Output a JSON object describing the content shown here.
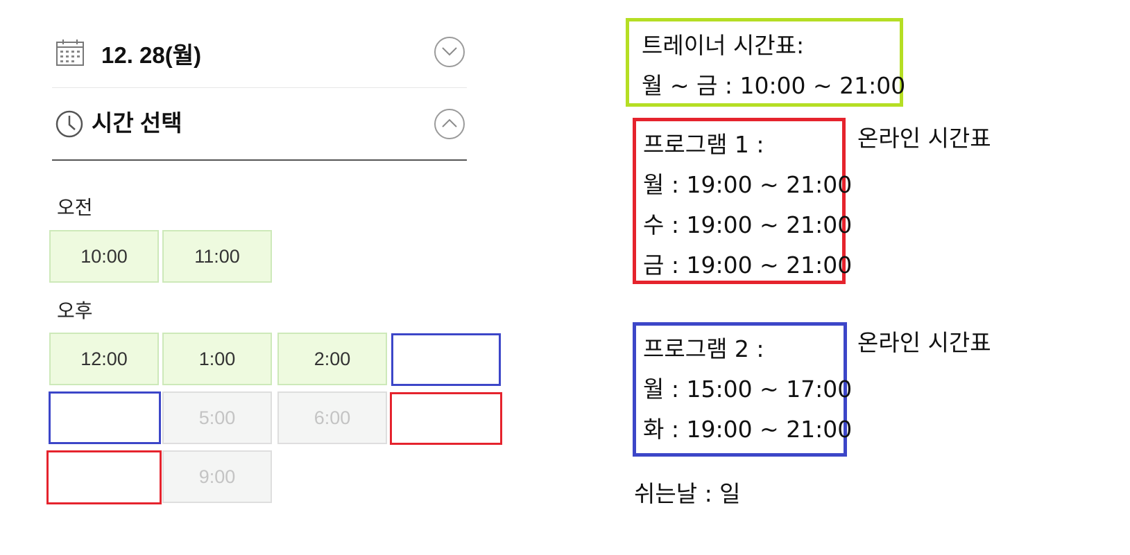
{
  "date_row": {
    "icon": "calendar-icon",
    "label": "12. 28(월)",
    "toggle_icon": "chevron-down-icon"
  },
  "time_row": {
    "icon": "clock-icon",
    "label": "시간 선택",
    "toggle_icon": "chevron-up-icon"
  },
  "morning": {
    "label": "오전",
    "slots": [
      "10:00",
      "11:00"
    ]
  },
  "afternoon": {
    "label": "오후",
    "slots": [
      "12:00",
      "1:00",
      "2:00",
      "",
      "",
      "5:00",
      "6:00",
      "",
      "",
      "9:00"
    ]
  },
  "colors": {
    "slot_open_bg": "#eefadf",
    "slot_closed_bg": "#f4f5f4",
    "green_box": "#b5de24",
    "red_box": "#e5232d",
    "blue_box": "#3c46c8"
  },
  "trainer": {
    "title": "트레이너 시간표:",
    "hours": "월 ~ 금 : 10:00 ~ 21:00"
  },
  "program1": {
    "title": "프로그램 1 :",
    "lines": [
      "월 : 19:00 ~ 21:00",
      "수 : 19:00 ~ 21:00",
      "금 : 19:00 ~ 21:00"
    ],
    "note": "온라인 시간표"
  },
  "program2": {
    "title": "프로그램 2 :",
    "lines": [
      "월 : 15:00 ~ 17:00",
      "화 : 19:00 ~ 21:00"
    ],
    "note": "온라인 시간표"
  },
  "day_off": "쉬는날 : 일"
}
